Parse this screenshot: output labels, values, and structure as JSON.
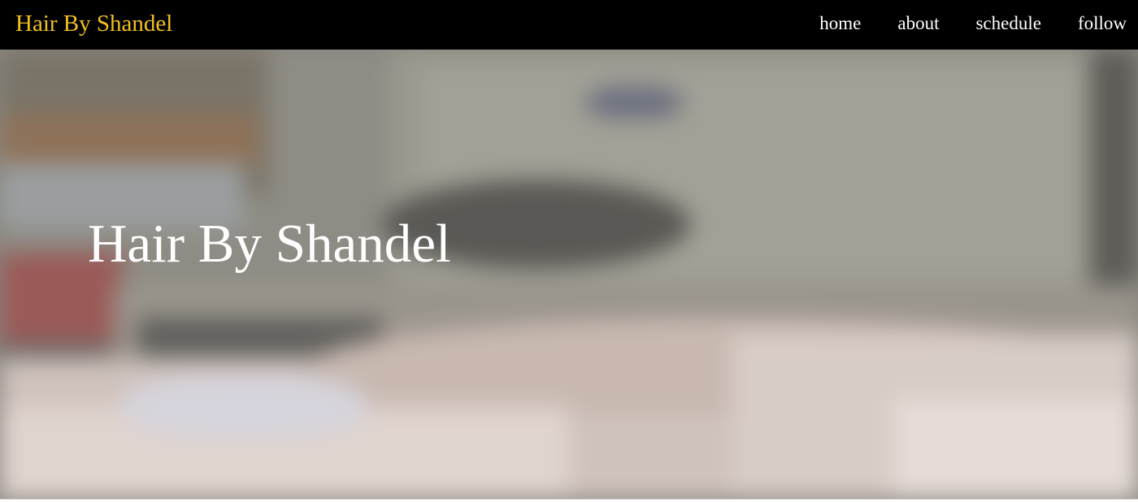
{
  "navbar": {
    "brand": "Hair By Shandel",
    "links": [
      "home",
      "about",
      "schedule",
      "follow"
    ]
  },
  "hero": {
    "title": "Hair By Shandel"
  },
  "colors": {
    "navbar_bg": "#000000",
    "brand": "#f4c01e",
    "nav_link": "#ffffff",
    "hero_title": "#ffffff"
  }
}
